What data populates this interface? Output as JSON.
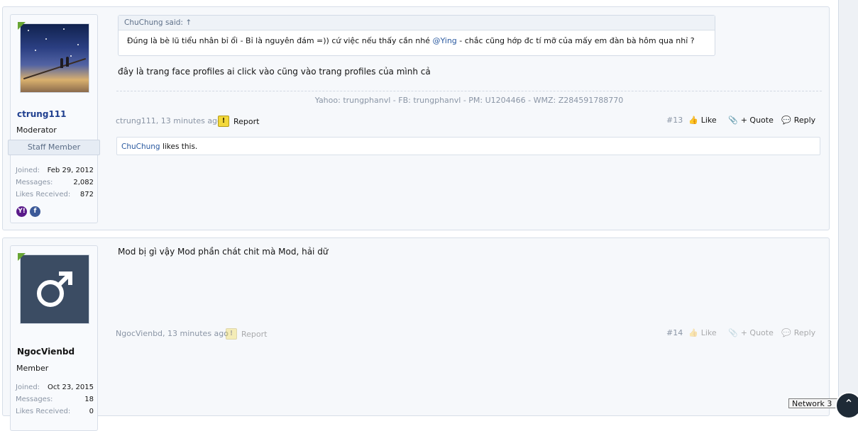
{
  "posts": [
    {
      "user": {
        "name": "ctrung111",
        "role": "Moderator",
        "staff_label": "Staff Member",
        "stats": [
          {
            "label": "Joined:",
            "value": "Feb 29, 2012"
          },
          {
            "label": "Messages:",
            "value": "2,082"
          },
          {
            "label": "Likes Received:",
            "value": "872"
          }
        ],
        "identities": [
          "yahoo-icon",
          "facebook-icon"
        ]
      },
      "quote": {
        "header": "ChuChung said:",
        "body_before": "Đúng là bè lũ tiểu nhân bỉ ổi - Bỉ là nguyên đám =)) cứ việc nếu thấy cần nhé",
        "mention": "@Ying",
        "body_after": "- chắc cũng hớp đc tí mỡ của mấy em đàn bà hôm qua nhỉ ?"
      },
      "message": "đây là trang face profiles ai click vào cũng vào trang profiles của mình cả",
      "signature": "Yahoo: trungphanvl - FB: trungphanvl - PM: U1204466 - WMZ: Z284591788770",
      "meta": "ctrung111, 13 minutes ago",
      "report": "Report",
      "post_number": "#13",
      "like": "Like",
      "quote_label": "+ Quote",
      "reply": "Reply",
      "likes_who": "ChuChung",
      "likes_text": " likes this."
    },
    {
      "user": {
        "name": "NgocVienbd",
        "role": "Member",
        "stats": [
          {
            "label": "Joined:",
            "value": "Oct 23, 2015"
          },
          {
            "label": "Messages:",
            "value": "18"
          },
          {
            "label": "Likes Received:",
            "value": "0"
          }
        ]
      },
      "message": "Mod bị gì vậy Mod phần chát chit mà Mod, hải dữ",
      "meta": "NgocVienbd, 13 minutes ago",
      "report": "Report",
      "post_number": "#14",
      "like": "Like",
      "quote_label": "+ Quote",
      "reply": "Reply"
    }
  ],
  "network_label": "Network 3",
  "colors": {
    "accent": "#2b5aa0",
    "corner": "#68a534",
    "panel": "#f6f8fb"
  }
}
